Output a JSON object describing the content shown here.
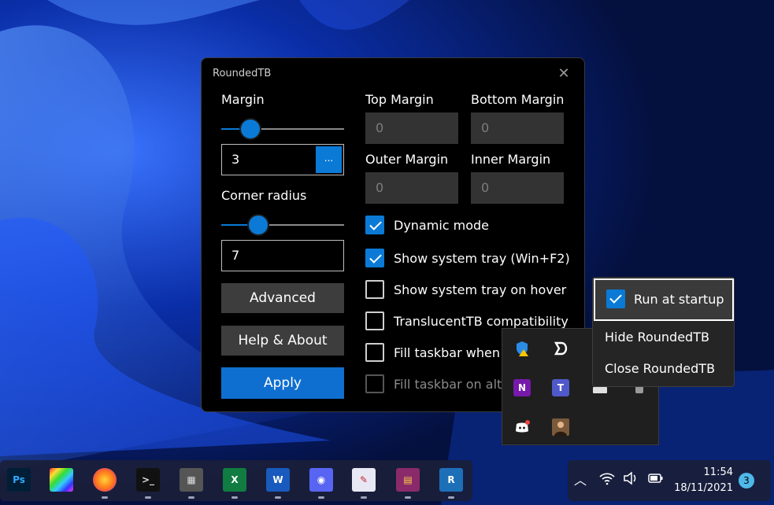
{
  "window": {
    "title": "RoundedTB",
    "close_glyph": "✕",
    "margin": {
      "label": "Margin",
      "slider_value": 3,
      "value": "3",
      "more_button": "..."
    },
    "corner_radius": {
      "label": "Corner radius",
      "slider_value": 7,
      "value": "7"
    },
    "slider_max": 40,
    "top_margin": {
      "label": "Top Margin",
      "value": "0"
    },
    "bottom_margin": {
      "label": "Bottom Margin",
      "value": "0"
    },
    "outer_margin": {
      "label": "Outer Margin",
      "value": "0"
    },
    "inner_margin": {
      "label": "Inner Margin",
      "value": "0"
    },
    "buttons": {
      "advanced": "Advanced",
      "help": "Help & About",
      "apply": "Apply"
    },
    "checkboxes": [
      {
        "label": "Dynamic mode",
        "checked": true,
        "disabled": false
      },
      {
        "label": "Show system tray (Win+F2)",
        "checked": true,
        "disabled": false
      },
      {
        "label": "Show system tray on hover",
        "checked": false,
        "disabled": false
      },
      {
        "label": "TranslucentTB compatibility",
        "checked": false,
        "disabled": false
      },
      {
        "label": "Fill taskbar when m",
        "checked": false,
        "disabled": false
      },
      {
        "label": "Fill taskbar on alt+",
        "checked": false,
        "disabled": true
      }
    ]
  },
  "context_menu": {
    "items": [
      {
        "label": "Run at startup",
        "checked": true
      },
      {
        "label": "Hide RoundedTB"
      },
      {
        "label": "Close RoundedTB"
      }
    ]
  },
  "tray_overflow": {
    "icons": [
      "security-warning-icon",
      "dashlane-icon",
      "onenote-icon",
      "teams-icon",
      "keyboard-icon",
      "usb-icon",
      "discord-icon",
      "user-photo-icon"
    ]
  },
  "taskbar": {
    "apps": [
      {
        "name": "photoshop-icon",
        "glyph": "Ps",
        "color": "#001e36",
        "fg": "#31a8ff",
        "running": false
      },
      {
        "name": "color-palette-icon",
        "glyph": "",
        "color": "#444",
        "fg": "#fff",
        "running": false
      },
      {
        "name": "firefox-icon",
        "glyph": "●",
        "color": "transparent",
        "fg": "#ff7a1a",
        "running": true
      },
      {
        "name": "terminal-icon",
        "glyph": ">_",
        "color": "#111",
        "fg": "#ddd",
        "running": true
      },
      {
        "name": "calculator-icon",
        "glyph": "▦",
        "color": "#555",
        "fg": "#ddd",
        "running": true
      },
      {
        "name": "excel-icon",
        "glyph": "X",
        "color": "#107c41",
        "fg": "#fff",
        "running": true
      },
      {
        "name": "word-icon",
        "glyph": "W",
        "color": "#185abd",
        "fg": "#fff",
        "running": true
      },
      {
        "name": "discord-icon",
        "glyph": "◉",
        "color": "#5865f2",
        "fg": "#fff",
        "running": true
      },
      {
        "name": "paint-icon",
        "glyph": "✎",
        "color": "#e8e8f4",
        "fg": "#c23",
        "running": true
      },
      {
        "name": "winrar-icon",
        "glyph": "▤",
        "color": "#8a2a6a",
        "fg": "#ffd24a",
        "running": true
      },
      {
        "name": "roundedtb-icon",
        "glyph": "R",
        "color": "#1d6fb8",
        "fg": "#fff",
        "running": true
      }
    ],
    "clock": {
      "time": "11:54",
      "date": "18/11/2021"
    },
    "notification_count": "3",
    "tray_glyphs": {
      "chevron": "︿",
      "wifi": "◠",
      "volume": "🔈",
      "battery": "▭"
    }
  }
}
